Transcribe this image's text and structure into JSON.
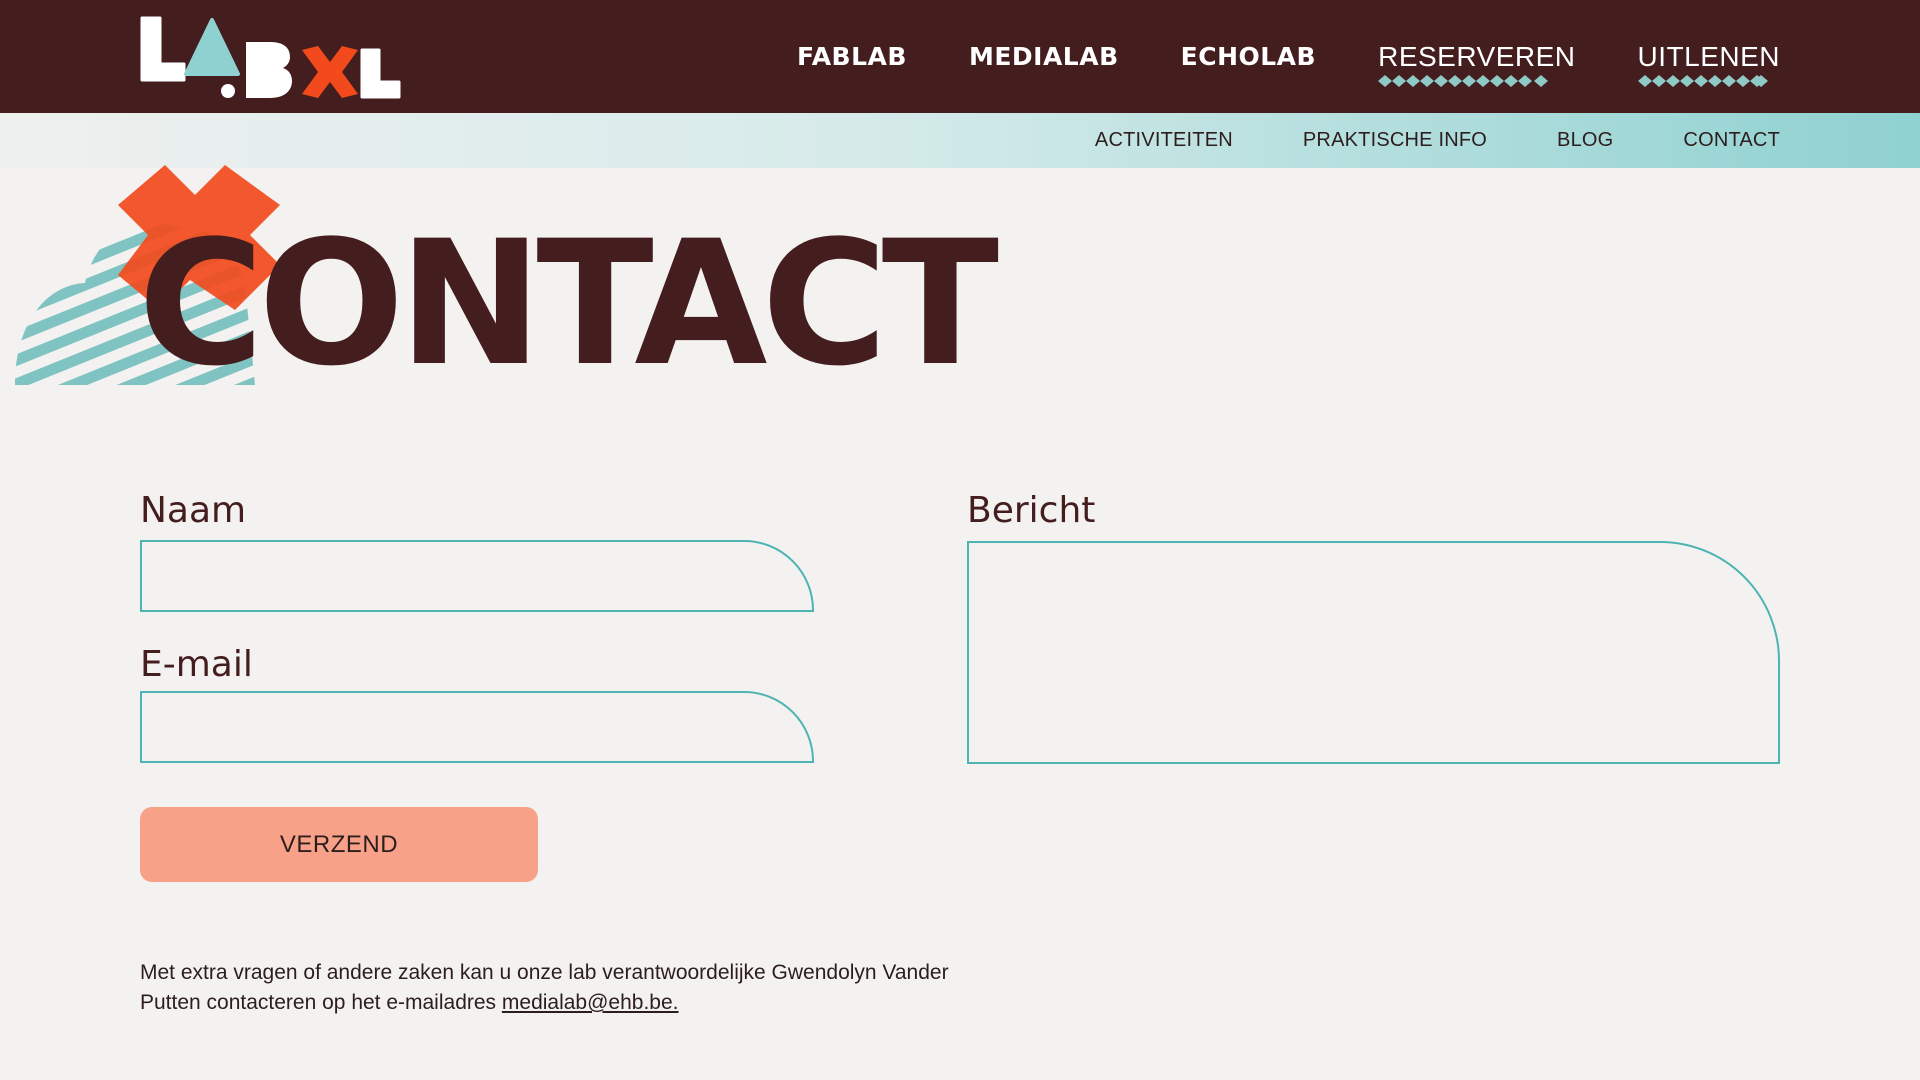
{
  "header": {
    "logo_alt": "LABXL",
    "nav": [
      {
        "label": "FABLAB"
      },
      {
        "label": "MEDIALAB"
      },
      {
        "label": "ECHOLAB"
      },
      {
        "label": "RESERVEREN"
      },
      {
        "label": "UITLENEN"
      }
    ]
  },
  "subnav": [
    {
      "label": "ACTIVITEITEN"
    },
    {
      "label": "PRAKTISCHE INFO"
    },
    {
      "label": "BLOG"
    },
    {
      "label": "CONTACT"
    }
  ],
  "hero": {
    "title": "CONTACT"
  },
  "form": {
    "name_label": "Naam",
    "name_value": "",
    "email_label": "E-mail",
    "email_value": "",
    "message_label": "Bericht",
    "message_value": "",
    "submit_label": "VERZEND"
  },
  "info": {
    "text": "Met extra vragen of andere zaken kan u onze lab verantwoordelijke Gwendolyn Vander Putten contacteren op het e-mailadres ",
    "email_link": "medialab@ehb.be."
  },
  "colors": {
    "dark_brown": "#441d1e",
    "teal": "#4eb3b3",
    "orange": "#f24a1c",
    "button": "#f8a189",
    "background": "#f4f2f0"
  }
}
